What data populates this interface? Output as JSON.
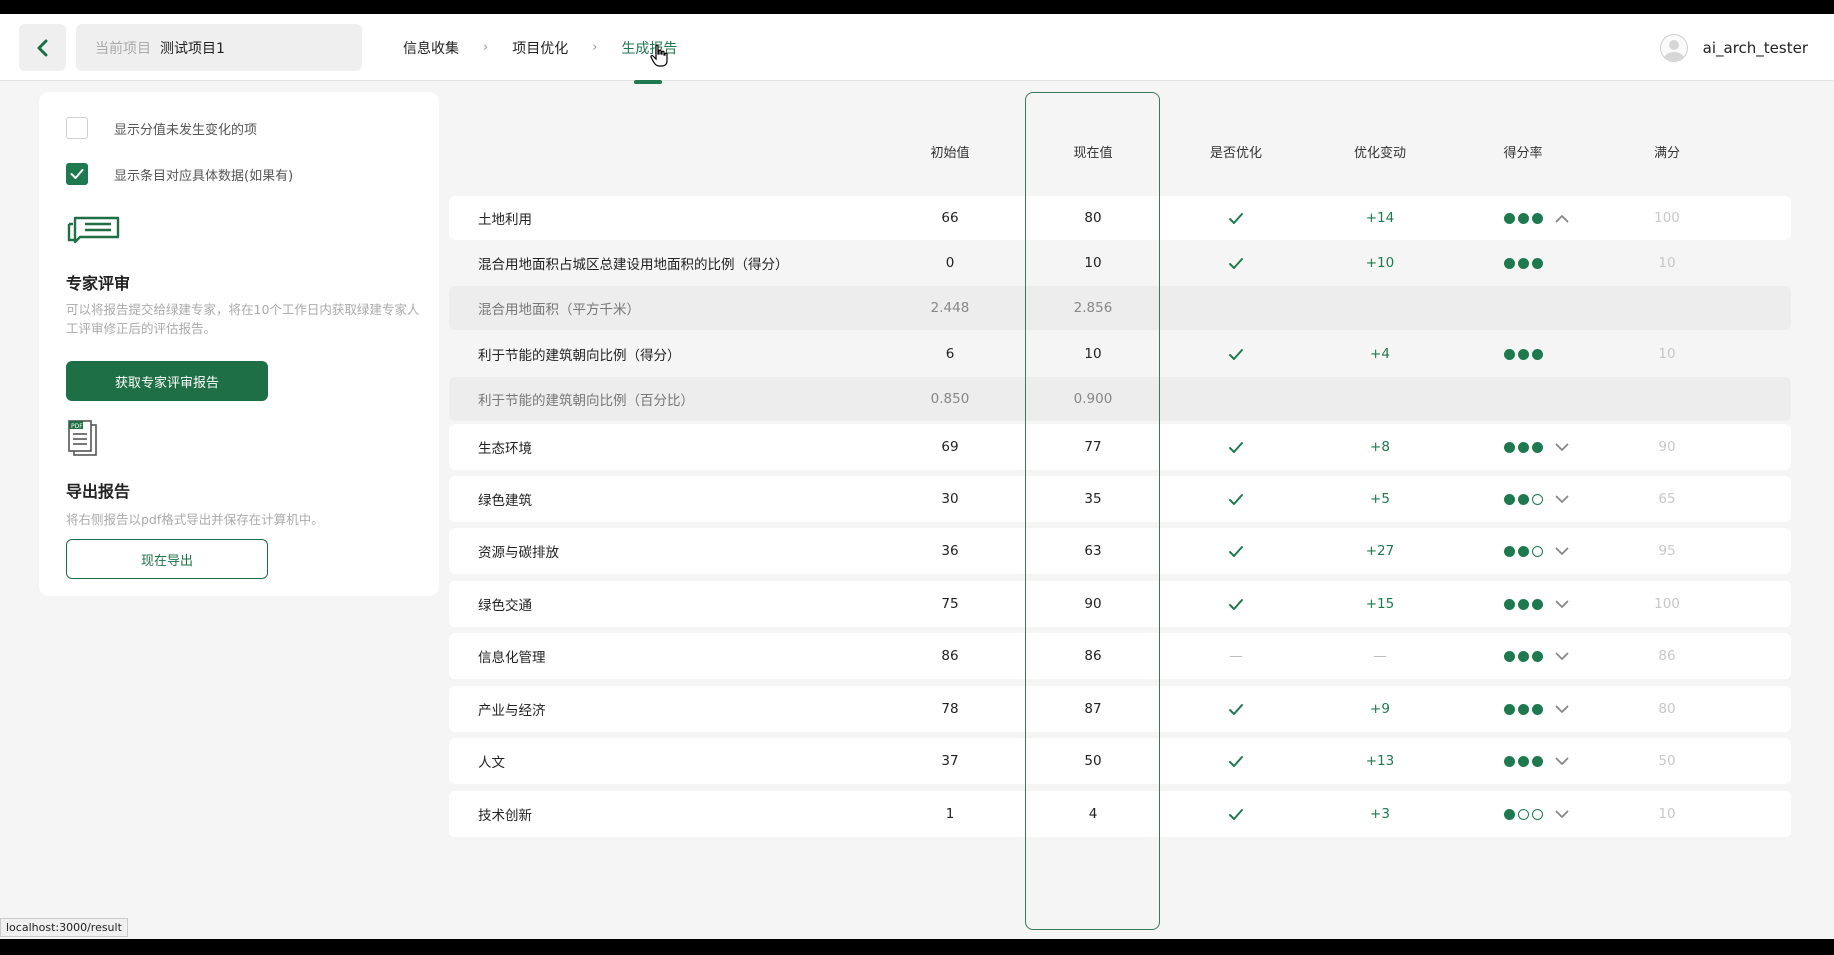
{
  "header": {
    "project_label": "当前项目",
    "project_name": "测试项目1",
    "steps": [
      "信息收集",
      "项目优化",
      "生成报告"
    ],
    "active_step": "生成报告",
    "username": "ai_arch_tester"
  },
  "sidebar": {
    "option_unchanged": "显示分值未发生变化的项",
    "option_unchanged_checked": false,
    "option_detail": "显示条目对应具体数据(如果有)",
    "option_detail_checked": true,
    "expert_title": "专家评审",
    "expert_desc": "可以将报告提交给绿建专家，将在10个工作日内获取绿建专家人工评审修正后的评估报告。",
    "expert_button": "获取专家评审报告",
    "export_title": "导出报告",
    "export_desc": "将右侧报告以pdf格式导出并保存在计算机中。",
    "export_button": "现在导出",
    "pdf_icon_text": "PDF"
  },
  "table": {
    "headers": {
      "initial": "初始值",
      "current": "现在值",
      "optimized": "是否优化",
      "change": "优化变动",
      "rate": "得分率",
      "full": "满分"
    },
    "rows": [
      {
        "name": "土地利用",
        "initial": "66",
        "current": "80",
        "optimized": true,
        "change": "+14",
        "rate": 3,
        "full": "100",
        "kind": "main",
        "expanded": true
      },
      {
        "name": "混合用地面积占城区总建设用地面积的比例（得分）",
        "initial": "0",
        "current": "10",
        "optimized": true,
        "change": "+10",
        "rate": 3,
        "full": "10",
        "kind": "sub"
      },
      {
        "name": "混合用地面积（平方千米）",
        "initial": "2.448",
        "current": "2.856",
        "kind": "sub2"
      },
      {
        "name": "利于节能的建筑朝向比例（得分）",
        "initial": "6",
        "current": "10",
        "optimized": true,
        "change": "+4",
        "rate": 3,
        "full": "10",
        "kind": "sub"
      },
      {
        "name": "利于节能的建筑朝向比例（百分比）",
        "initial": "0.850",
        "current": "0.900",
        "kind": "sub2"
      },
      {
        "name": "生态环境",
        "initial": "69",
        "current": "77",
        "optimized": true,
        "change": "+8",
        "rate": 3,
        "full": "90",
        "kind": "main"
      },
      {
        "name": "绿色建筑",
        "initial": "30",
        "current": "35",
        "optimized": true,
        "change": "+5",
        "rate": 2,
        "full": "65",
        "kind": "main"
      },
      {
        "name": "资源与碳排放",
        "initial": "36",
        "current": "63",
        "optimized": true,
        "change": "+27",
        "rate": 2,
        "full": "95",
        "kind": "main"
      },
      {
        "name": "绿色交通",
        "initial": "75",
        "current": "90",
        "optimized": true,
        "change": "+15",
        "rate": 3,
        "full": "100",
        "kind": "main"
      },
      {
        "name": "信息化管理",
        "initial": "86",
        "current": "86",
        "optimized": false,
        "change": "—",
        "rate": 3,
        "full": "86",
        "kind": "main"
      },
      {
        "name": "产业与经济",
        "initial": "78",
        "current": "87",
        "optimized": true,
        "change": "+9",
        "rate": 3,
        "full": "80",
        "kind": "main"
      },
      {
        "name": "人文",
        "initial": "37",
        "current": "50",
        "optimized": true,
        "change": "+13",
        "rate": 3,
        "full": "50",
        "kind": "main"
      },
      {
        "name": "技术创新",
        "initial": "1",
        "current": "4",
        "optimized": true,
        "change": "+3",
        "rate": 1,
        "full": "10",
        "kind": "main"
      }
    ],
    "not_optimized_mark": "—"
  },
  "status_bar": {
    "url": "localhost:3000/result"
  },
  "colors": {
    "accent": "#1e7a4e",
    "button": "#1e6f45"
  }
}
